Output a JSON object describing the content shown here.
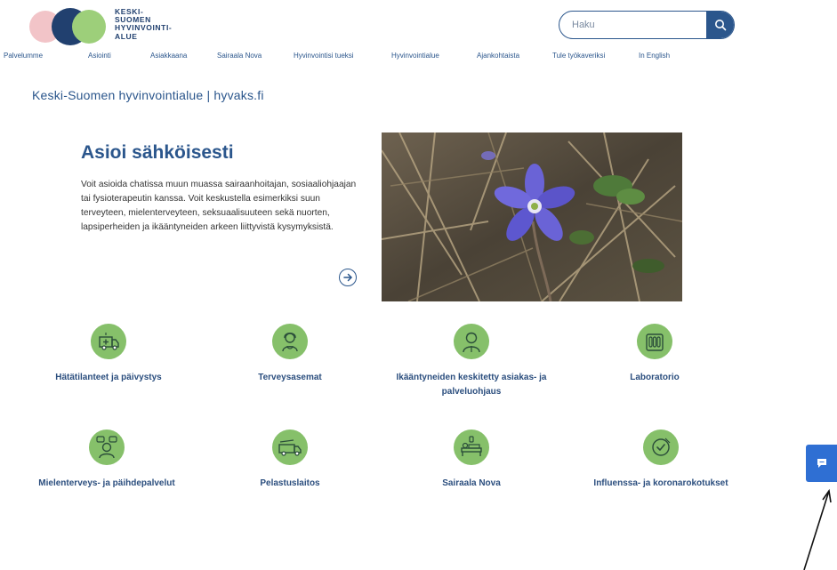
{
  "brand": {
    "logo_text": "KESKI-\nSUOMEN\nHYVINVOINTI-\nALUE",
    "colors": {
      "primary": "#2b568c",
      "green": "#86c06a",
      "pink": "#f2c4c8",
      "chat": "#2f6fd3"
    }
  },
  "search": {
    "placeholder": "Haku",
    "icon": "search-icon"
  },
  "nav": [
    "Palvelumme",
    "Asiointi",
    "Asiakkaana",
    "Sairaala Nova",
    "Hyvinvointisi tueksi",
    "Hyvinvointialue",
    "Ajankohtaista",
    "Tule työkaveriksi",
    "In English"
  ],
  "site_title": "Keski-Suomen hyvinvointialue | hyvaks.fi",
  "hero": {
    "title": "Asioi sähköisesti",
    "text": "Voit asioida chatissa muun muassa sairaanhoitajan, sosiaaliohjaajan tai fysioterapeutin kanssa. Voit keskustella esimerkiksi suun terveyteen, mielenterveyteen, seksuaalisuuteen sekä nuorten, lapsiperheiden ja ikääntyneiden arkeen liittyvistä kysymyksistä.",
    "arrow_icon": "arrow-right-circle-icon",
    "image": "hepatica-flower-photo"
  },
  "services": [
    {
      "label": "Hätätilanteet ja päivystys",
      "icon": "ambulance-icon"
    },
    {
      "label": "Terveysasemat",
      "icon": "nurse-icon"
    },
    {
      "label": "Ikääntyneiden keskitetty asiakas- ja palveluohjaus",
      "icon": "elderly-person-icon"
    },
    {
      "label": "Laboratorio",
      "icon": "test-tubes-icon"
    },
    {
      "label": "Mielenterveys- ja päihdepalvelut",
      "icon": "conversation-person-icon"
    },
    {
      "label": "Pelastuslaitos",
      "icon": "fire-truck-icon"
    },
    {
      "label": "Sairaala Nova",
      "icon": "hospital-bed-icon"
    },
    {
      "label": "Influenssa- ja koronarokotukset",
      "icon": "vaccination-check-icon"
    }
  ],
  "chat": {
    "icon": "chat-icon"
  }
}
